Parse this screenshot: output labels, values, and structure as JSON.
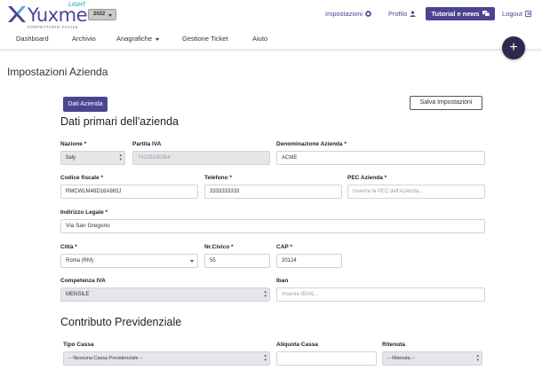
{
  "header": {
    "logo_text": "Yuxme",
    "logo_light": "LIGHT",
    "logo_sub": "FORFETTARIO FACILE",
    "year": "2022",
    "impostazioni": "Impostazioni",
    "profilo": "Profilo",
    "tutorial": "Tutorial e news",
    "logout": "Logout"
  },
  "nav": [
    "Dashboard",
    "Archivio",
    "Anagrafiche",
    "Gestione Ticket",
    "Aiuto"
  ],
  "fab_label": "+",
  "page": {
    "title": "Impostazioni Azienda",
    "tab": "Dati Azienda",
    "save": "Salva Impostazioni"
  },
  "sections": {
    "primary": "Dati primari dell'azienda",
    "contrib": "Contributo Previdenziale"
  },
  "fields": {
    "nazione_label": "Nazione *",
    "nazione_value": "Italy",
    "piva_label": "Partita IVA",
    "piva_value": "74239240364",
    "denom_label": "Denominazione Azienda *",
    "denom_value": "ACME",
    "cf_label": "Codice fiscale *",
    "cf_value": "RMCWLM48D16A983J",
    "tel_label": "Telefono *",
    "tel_value": "3333333333",
    "pec_label": "PEC Azienda *",
    "pec_placeholder": "Inserire la PEC dell'Azienda...",
    "indirizzo_label": "Indirizzo Legale *",
    "indirizzo_value": "Via San Gregorio",
    "citta_label": "Città *",
    "citta_value": "Roma (RM)",
    "civico_label": "Nr.Civico *",
    "civico_value": "55",
    "cap_label": "CAP *",
    "cap_value": "20124",
    "competenza_label": "Competenza IVA",
    "competenza_value": "MENSILE",
    "iban_label": "Iban",
    "iban_placeholder": "Inserire IBAN...",
    "cassa_label": "Tipo Cassa",
    "cassa_value": "-- Nessuna Cassa Previdenziale --",
    "aliquota_label": "Aliquota Cassa",
    "ritenuta_label": "Ritenuta",
    "ritenuta_value": "-- Ritenuta --"
  },
  "colors": {
    "brand": "#4b4490",
    "fab": "#2b2a4d",
    "light_accent": "#4fb3d9"
  }
}
